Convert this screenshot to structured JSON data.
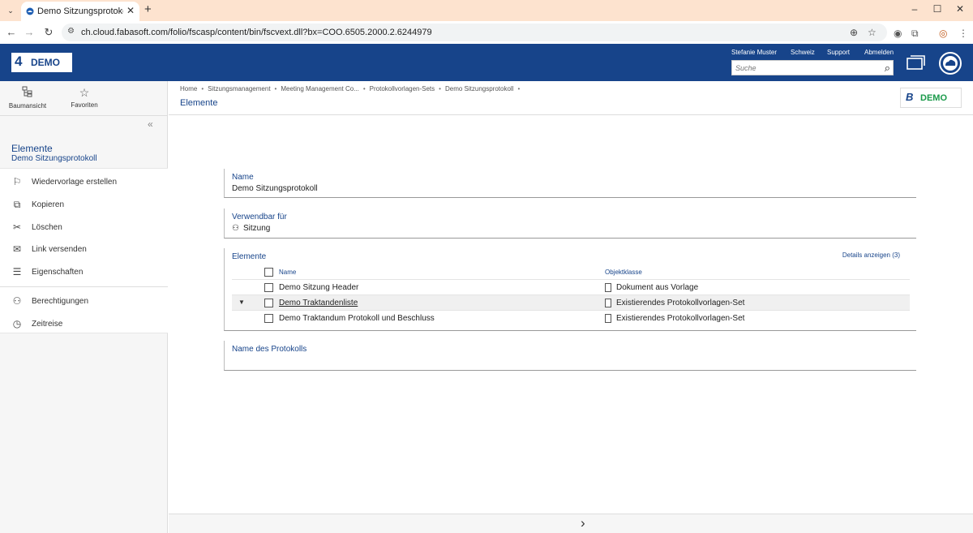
{
  "browser": {
    "tab_title": "Demo Sitzungsprotokoll (Protok",
    "url": "ch.cloud.fabasoft.com/folio/fscasp/content/bin/fscvext.dll?bx=COO.6505.2000.2.6244979"
  },
  "header": {
    "logo_mark": "4",
    "logo_text": "DEMO",
    "links": [
      "Stefanie Muster",
      "Schweiz",
      "Support",
      "Abmelden"
    ],
    "search_placeholder": "Suche"
  },
  "sidebar": {
    "tools": [
      {
        "label": "Baumansicht",
        "icon": "tree-view-icon"
      },
      {
        "label": "Favoriten",
        "icon": "star-icon"
      }
    ],
    "context_title": "Elemente",
    "context_subtitle": "Demo Sitzungsprotokoll",
    "actions": [
      {
        "label": "Wiedervorlage erstellen",
        "icon": "flag-icon"
      },
      {
        "label": "Kopieren",
        "icon": "copy-icon"
      },
      {
        "label": "Löschen",
        "icon": "delete-icon"
      },
      {
        "label": "Link versenden",
        "icon": "mail-icon"
      },
      {
        "label": "Eigenschaften",
        "icon": "properties-icon"
      },
      {
        "label": "Berechtigungen",
        "icon": "users-icon"
      },
      {
        "label": "Zeitreise",
        "icon": "clock-icon"
      }
    ]
  },
  "content": {
    "breadcrumb": [
      "Home",
      "Sitzungsmanagement",
      "Meeting Management Co...",
      "Protokollvorlagen-Sets",
      "Demo Sitzungsprotokoll"
    ],
    "page_title": "Elemente",
    "brand_mark": "B",
    "brand_text": "DEMO",
    "fields": {
      "name": {
        "label": "Name",
        "value": "Demo Sitzungsprotokoll"
      },
      "usable_for": {
        "label": "Verwendbar für",
        "value": "Sitzung"
      },
      "elements": {
        "label": "Elemente",
        "details_link": "Details anzeigen (3)",
        "columns": [
          "Name",
          "Objektklasse"
        ],
        "rows": [
          {
            "name": "Demo Sitzung Header",
            "class": "Dokument aus Vorlage"
          },
          {
            "name": "Demo Traktandenliste",
            "class": "Existierendes Protokollvorlagen-Set"
          },
          {
            "name": "Demo Traktandum Protokoll und Beschluss",
            "class": "Existierendes Protokollvorlagen-Set"
          }
        ]
      },
      "protocol_name": {
        "label": "Name des Protokolls",
        "value": ""
      }
    }
  }
}
